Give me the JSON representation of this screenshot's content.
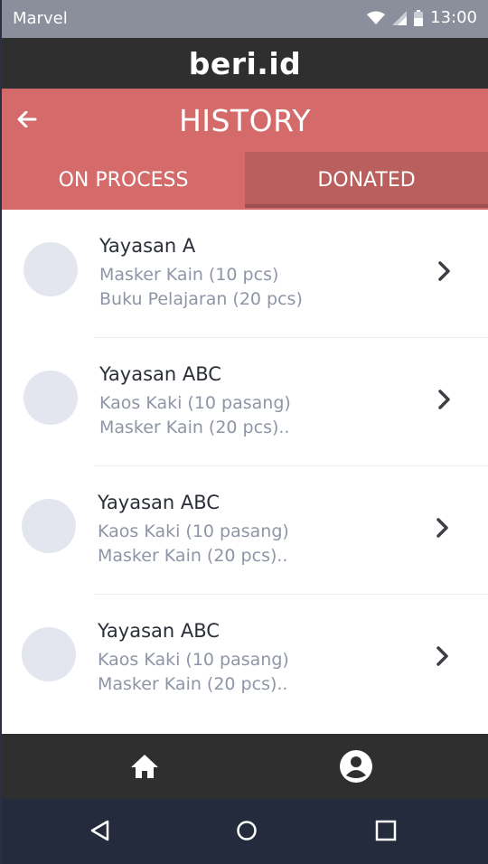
{
  "status_bar": {
    "carrier": "Marvel",
    "time": "13:00"
  },
  "app": {
    "brand": "beri.id"
  },
  "header": {
    "title": "HISTORY",
    "tabs": [
      {
        "label": "ON PROCESS",
        "active": false
      },
      {
        "label": "DONATED",
        "active": true
      }
    ]
  },
  "items": [
    {
      "title": "Yayasan A",
      "line1": "Masker Kain (10 pcs)",
      "line2": "Buku Pelajaran (20 pcs)"
    },
    {
      "title": "Yayasan ABC",
      "line1": "Kaos Kaki (10 pasang)",
      "line2": "Masker Kain (20 pcs).."
    },
    {
      "title": "Yayasan ABC",
      "line1": "Kaos Kaki (10 pasang)",
      "line2": "Masker Kain (20 pcs).."
    },
    {
      "title": "Yayasan ABC",
      "line1": "Kaos Kaki (10 pasang)",
      "line2": "Masker Kain (20 pcs).."
    }
  ],
  "icons": {
    "back": "arrow-left-icon",
    "chevron": "chevron-right-icon",
    "home": "home-icon",
    "profile": "user-circle-icon",
    "sys_back": "triangle-back-icon",
    "sys_home": "circle-home-icon",
    "sys_recent": "square-recent-icon"
  },
  "colors": {
    "header": "#d46b6a",
    "tab_active": "#b95f5e",
    "app_bar": "#2f2f2f",
    "system_nav": "#242b3d",
    "status_bar": "#8a8f9b"
  }
}
